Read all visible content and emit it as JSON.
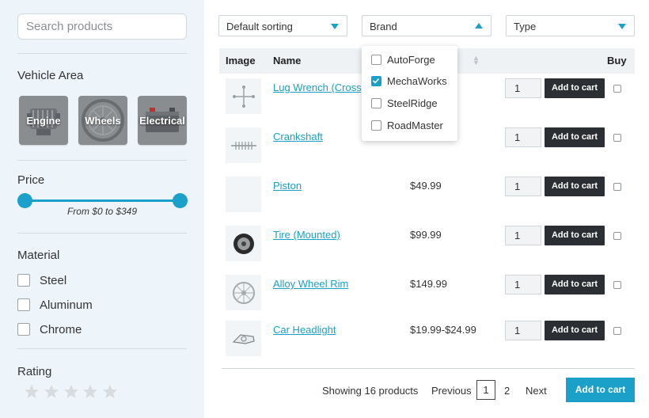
{
  "sidebar": {
    "search_placeholder": "Search products",
    "vehicle_area": {
      "title": "Vehicle Area",
      "items": [
        {
          "label": "Engine",
          "icon": "engine-icon"
        },
        {
          "label": "Wheels",
          "icon": "wheel-icon"
        },
        {
          "label": "Electrical",
          "icon": "battery-icon"
        }
      ]
    },
    "price": {
      "title": "Price",
      "range_text": "From $0 to $349",
      "min": 0,
      "max": 349
    },
    "material": {
      "title": "Material",
      "options": [
        "Steel",
        "Aluminum",
        "Chrome"
      ]
    },
    "rating": {
      "title": "Rating",
      "stars": 5,
      "selected": 0
    }
  },
  "toolbar": {
    "sort_label": "Default sorting",
    "brand_label": "Brand",
    "type_label": "Type"
  },
  "brand_dropdown": {
    "options": [
      {
        "label": "AutoForge",
        "checked": false
      },
      {
        "label": "MechaWorks",
        "checked": true
      },
      {
        "label": "SteelRidge",
        "checked": false
      },
      {
        "label": "RoadMaster",
        "checked": false
      }
    ]
  },
  "table": {
    "headers": {
      "image": "Image",
      "name": "Name",
      "buy": "Buy"
    },
    "rows": [
      {
        "name": "Lug Wrench (Cross)",
        "price": "",
        "qty": "1",
        "button": "Add to cart",
        "icon": "lug-wrench-icon"
      },
      {
        "name": "Crankshaft",
        "price": "",
        "qty": "1",
        "button": "Add to cart",
        "icon": "crankshaft-icon"
      },
      {
        "name": "Piston",
        "price": "$49.99",
        "qty": "1",
        "button": "Add to cart",
        "icon": "piston-icon"
      },
      {
        "name": "Tire (Mounted)",
        "price": "$99.99",
        "qty": "1",
        "button": "Add to cart",
        "icon": "tire-icon"
      },
      {
        "name": "Alloy Wheel Rim",
        "price": "$149.99",
        "qty": "1",
        "button": "Add to cart",
        "icon": "wheel-rim-icon"
      },
      {
        "name": "Car Headlight",
        "price": "$19.99-$24.99",
        "qty": "1",
        "button": "Add to cart",
        "icon": "headlight-icon"
      }
    ]
  },
  "footer": {
    "showing": "Showing 16 products",
    "previous": "Previous",
    "pages": [
      "1",
      "2"
    ],
    "next": "Next",
    "add_to_cart": "Add to cart"
  },
  "colors": {
    "accent": "#1aa0c9",
    "dark_button": "#2b2f33",
    "sidebar_bg": "#eef5fa"
  }
}
